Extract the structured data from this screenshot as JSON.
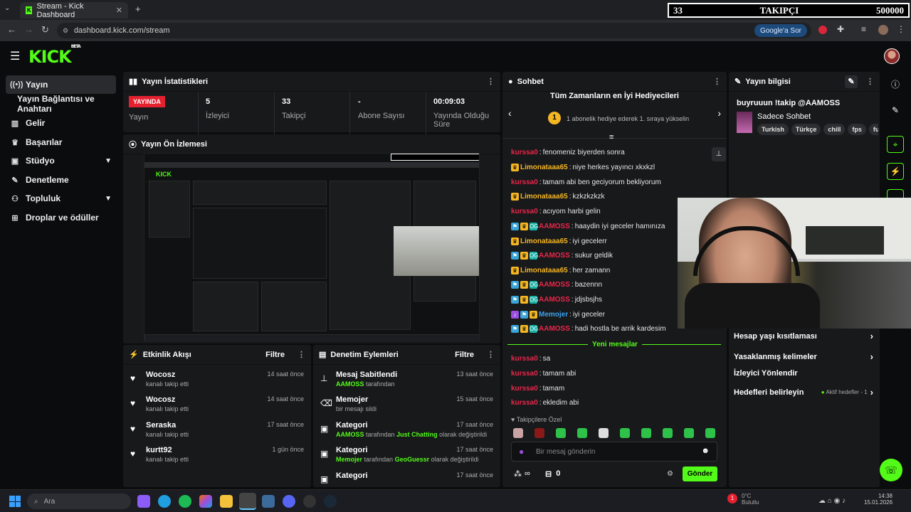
{
  "browser": {
    "tab_title": "Stream - Kick Dashboard",
    "url": "dashboard.kick.com/stream",
    "google_button": "Google'a Sor"
  },
  "overlay_counter": {
    "current": "33",
    "label": "TAKIPÇI",
    "goal": "500000"
  },
  "header": {
    "logo": "KICK",
    "logo_sup": "BETA"
  },
  "sidebar": {
    "items": [
      {
        "label": "Yayın",
        "icon": "broadcast-icon"
      },
      {
        "label": "Yayın Bağlantısı ve Anahtarı",
        "icon": ""
      },
      {
        "label": "Gelir",
        "icon": "chart-icon"
      },
      {
        "label": "Başarılar",
        "icon": "trophy-icon"
      },
      {
        "label": "Stüdyo",
        "icon": "studio-icon"
      },
      {
        "label": "Denetleme",
        "icon": "wrench-icon"
      },
      {
        "label": "Topluluk",
        "icon": "people-icon"
      },
      {
        "label": "Droplar ve ödüller",
        "icon": "gift-icon"
      }
    ]
  },
  "stats": {
    "title": "Yayın İstatistikleri",
    "live_label": "YAYINDA",
    "items": [
      {
        "value": "",
        "label": "Yayın"
      },
      {
        "value": "5",
        "label": "İzleyici"
      },
      {
        "value": "33",
        "label": "Takipçi"
      },
      {
        "value": "-",
        "label": "Abone Sayısı"
      },
      {
        "value": "00:09:03",
        "label": "Yayında Olduğu Süre"
      }
    ]
  },
  "preview": {
    "title": "Yayın Ön İzlemesi"
  },
  "activity": {
    "title": "Etkinlik Akışı",
    "filter": "Filtre",
    "rows": [
      {
        "name": "Wocosz",
        "sub": "kanalı takip etti",
        "time": "14 saat önce"
      },
      {
        "name": "Wocosz",
        "sub": "kanalı takip etti",
        "time": "14 saat önce"
      },
      {
        "name": "Seraska",
        "sub": "kanalı takip etti",
        "time": "17 saat önce"
      },
      {
        "name": "kurtt92",
        "sub": "kanalı takip etti",
        "time": "1 gün önce"
      }
    ]
  },
  "moderation": {
    "title": "Denetim Eylemleri",
    "filter": "Filtre",
    "rows": [
      {
        "title": "Mesaj Sabitlendi",
        "user": "AAMOSS",
        "sub": "tarafından",
        "extra": "",
        "tail": "",
        "time": "13 saat önce",
        "icon": "pin-icon"
      },
      {
        "title": "Memojer",
        "user": "",
        "sub": "bir mesajı sildi",
        "extra": "",
        "tail": "",
        "time": "15 saat önce",
        "icon": "trash-icon"
      },
      {
        "title": "Kategori",
        "user": "AAMOSS",
        "sub": "tarafından",
        "extra": "Just Chatting",
        "tail": "olarak değiştirildi",
        "time": "17 saat önce",
        "icon": "category-icon"
      },
      {
        "title": "Kategori",
        "user": "Memojer",
        "sub": "tarafından",
        "extra": "GeoGuessr",
        "tail": "olarak değiştirildi",
        "time": "17 saat önce",
        "icon": "category-icon"
      },
      {
        "title": "Kategori",
        "user": "",
        "sub": "",
        "extra": "",
        "tail": "",
        "time": "17 saat önce",
        "icon": "category-icon"
      }
    ]
  },
  "chat": {
    "title": "Sohbet",
    "gifters_title": "Tüm Zamanların en İyi Hediyecileri",
    "gifters_rank": "1",
    "gifters_text": "1 abonelik hediye ederek 1. sıraya yükselin",
    "messages": [
      {
        "user": "kurssa0",
        "color": "red",
        "badges": [],
        "text": "fenomeniz biyerden sonra"
      },
      {
        "user": "Limonataaa65",
        "color": "gold",
        "badges": [
          "sub"
        ],
        "text": "niye herkes yayıncı xkxkzl"
      },
      {
        "user": "kurssa0",
        "color": "red",
        "badges": [],
        "text": "tamam abi ben geciyorum bekliyorum"
      },
      {
        "user": "Limonataaa65",
        "color": "gold",
        "badges": [
          "sub"
        ],
        "text": "kzkzkzkzk"
      },
      {
        "user": "kurssa0",
        "color": "red",
        "badges": [],
        "text": "acıyom harbi gelin"
      },
      {
        "user": "AAMOSS",
        "color": "red",
        "badges": [
          "blue",
          "sub",
          "og"
        ],
        "text": "haaydin iyi geceler hamınıza"
      },
      {
        "user": "Limonataaa65",
        "color": "gold",
        "badges": [
          "sub"
        ],
        "text": "iyi gecelerr"
      },
      {
        "user": "AAMOSS",
        "color": "red",
        "badges": [
          "blue",
          "sub",
          "og"
        ],
        "text": "sukur geldik"
      },
      {
        "user": "Limonataaa65",
        "color": "gold",
        "badges": [
          "sub"
        ],
        "text": "her zamann"
      },
      {
        "user": "AAMOSS",
        "color": "red",
        "badges": [
          "blue",
          "sub",
          "og"
        ],
        "text": "bazennn"
      },
      {
        "user": "AAMOSS",
        "color": "red",
        "badges": [
          "blue",
          "sub",
          "og"
        ],
        "text": "jdjsbsjhs"
      },
      {
        "user": "Memojer",
        "color": "blue",
        "badges": [
          "mic",
          "blue",
          "sub"
        ],
        "text": "iyi geceler"
      },
      {
        "user": "AAMOSS",
        "color": "red",
        "badges": [
          "blue",
          "sub",
          "og"
        ],
        "text": "hadi hostla be arrik kardesim"
      }
    ],
    "new_messages_label": "Yeni mesajlar",
    "new_messages": [
      {
        "user": "kurssa0",
        "text": "sa"
      },
      {
        "user": "kurssa0",
        "text": "tamam abi"
      },
      {
        "user": "kurssa0",
        "text": "tamam"
      },
      {
        "user": "kurssa0",
        "text": "ekledim abi"
      }
    ],
    "followers_only": "Takipçilere Özel",
    "input_placeholder": "Bir mesaj gönderin",
    "points": "∞",
    "gift_count": "0",
    "send_label": "Gönder"
  },
  "stream_info": {
    "title": "Yayın bilgisi",
    "stream_title": "buyruuun !takip @AAMOSS",
    "category": "Sadece Sohbet",
    "tags": [
      "Turkish",
      "Türkçe",
      "chill",
      "fps",
      "fu"
    ],
    "menu": [
      {
        "label": "Hesap yaşı kısıtlaması",
        "extra": ""
      },
      {
        "label": "Yasaklanmış kelimeler",
        "extra": ""
      },
      {
        "label": "İzleyici Yönlendir",
        "extra": ""
      },
      {
        "label": "Hedefleri belirleyin",
        "extra": "Aktif hedefler - 1"
      }
    ]
  },
  "taskbar": {
    "search_placeholder": "Ara",
    "time": "14:38",
    "date": "15.01.2026",
    "weather": "0°C Bulutlu"
  }
}
